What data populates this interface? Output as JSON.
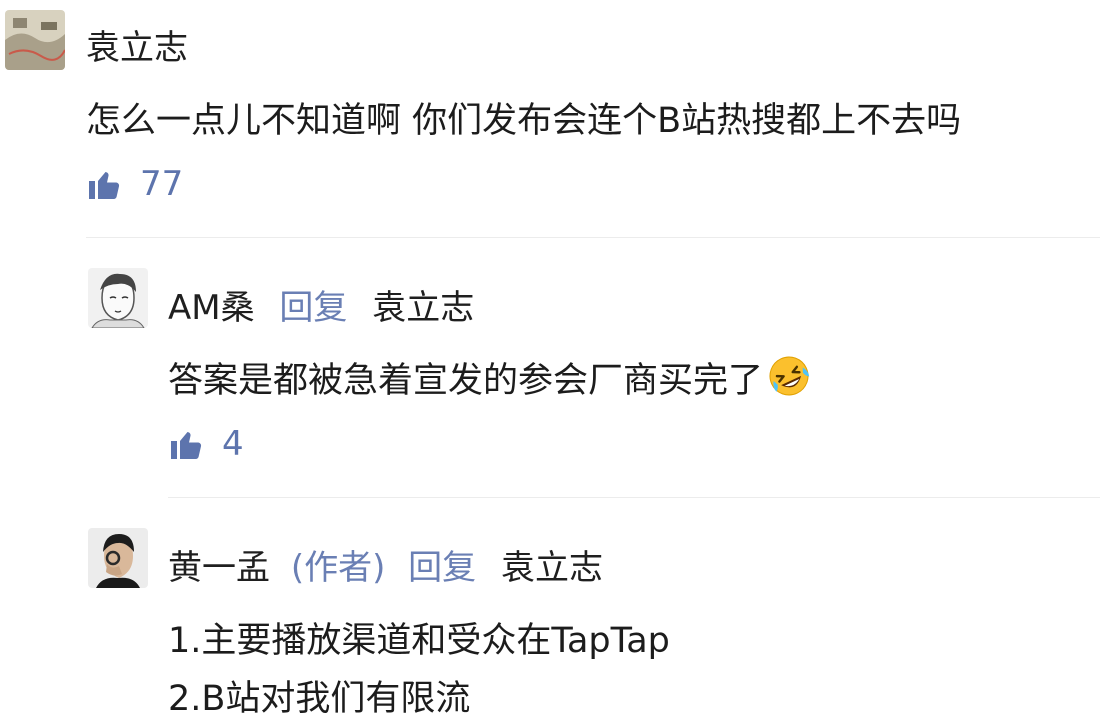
{
  "comments": [
    {
      "user": "袁立志",
      "text": "怎么一点儿不知道啊 你们发布会连个B站热搜都上不去吗",
      "likes": "77"
    },
    {
      "user": "AM桑",
      "reply_word": "回复",
      "reply_to": "袁立志",
      "text": "答案是都被急着宣发的参会厂商买完了",
      "emoji": "rofl-emoji",
      "likes": "4"
    },
    {
      "user": "黄一孟",
      "author_tag": "(作者)",
      "reply_word": "回复",
      "reply_to": "袁立志",
      "lines": [
        "1.主要播放渠道和受众在TapTap",
        "2.B站对我们有限流"
      ]
    }
  ],
  "icons": {
    "like": "thumbs-up-icon"
  },
  "colors": {
    "link": "#6a7fb4",
    "like": "#5d74ad",
    "text": "#1c1c1c",
    "divider": "#ececec"
  }
}
